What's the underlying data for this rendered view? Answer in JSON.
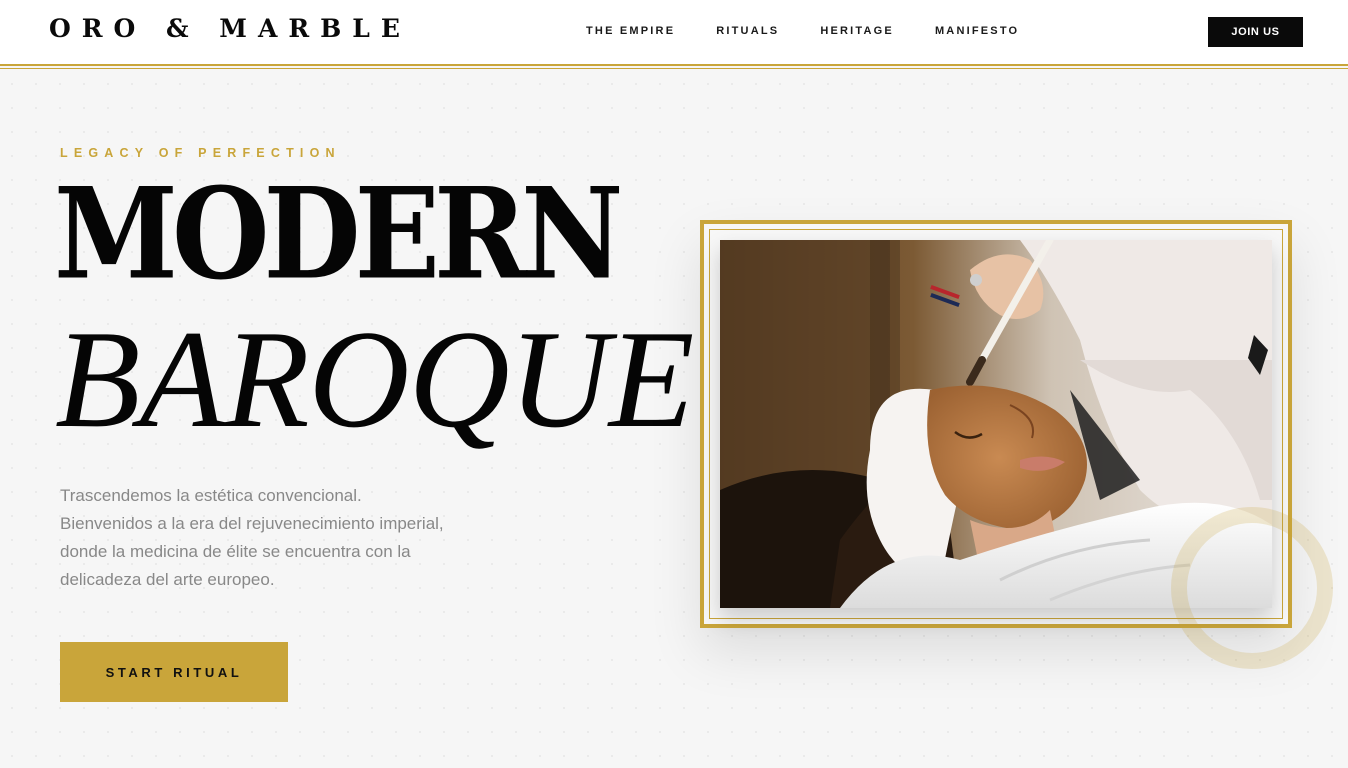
{
  "header": {
    "logo": "ORO & MARBLE",
    "nav": [
      "THE EMPIRE",
      "RITUALS",
      "HERITAGE",
      "MANIFESTO"
    ],
    "join_label": "JOIN US"
  },
  "hero": {
    "eyebrow": "LEGACY OF PERFECTION",
    "headline_line1": "MODERN",
    "headline_line2": "BAROQUE",
    "copy_lines": [
      "Trascendemos la estética convencional.",
      "Bienvenidos a la era del rejuvenecimiento imperial,",
      "donde la medicina de élite se encuentra con la",
      "delicadeza del arte europeo."
    ],
    "cta_label": "START RITUAL"
  },
  "image": {
    "subject": "facial-mask-treatment-photo"
  },
  "colors": {
    "accent_gold": "#c9a53a",
    "ink": "#0a0a0a",
    "background": "#f6f6f6",
    "body_text": "#888888"
  }
}
